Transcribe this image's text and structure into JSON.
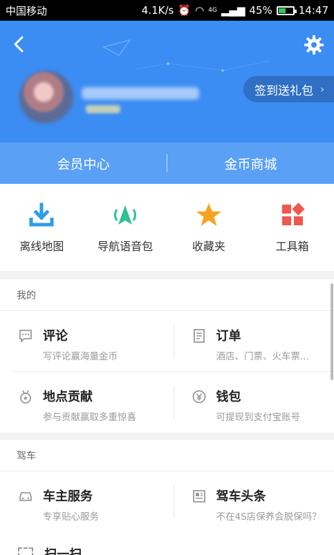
{
  "status_bar": {
    "carrier": "中国移动",
    "network_speed": "4.1K/s",
    "signal_label": "4G",
    "battery_percent_text": "45%",
    "battery_level": 0.45,
    "time": "14:47"
  },
  "header": {
    "signin_label": "签到送礼包",
    "background_color": "#3b8cf3"
  },
  "member_bar": {
    "member_center": "会员中心",
    "coin_mall": "金币商城"
  },
  "tools": [
    {
      "label": "离线地图",
      "icon": "download-icon",
      "color": "#2b9ee8"
    },
    {
      "label": "导航语音包",
      "icon": "voice-navigation-icon",
      "color": "#2ec28f"
    },
    {
      "label": "收藏夹",
      "icon": "star-icon",
      "color": "#f7a321"
    },
    {
      "label": "工具箱",
      "icon": "toolbox-icon",
      "color": "#f0584e"
    }
  ],
  "mine": {
    "title": "我的",
    "items": [
      {
        "title": "评论",
        "desc": "写评论赢海量金币",
        "icon": "comment-icon"
      },
      {
        "title": "订单",
        "desc": "酒店、门票、火车票...",
        "icon": "order-icon"
      },
      {
        "title": "地点贡献",
        "desc": "参与贡献赢取多重惊喜",
        "icon": "medal-icon"
      },
      {
        "title": "钱包",
        "desc": "可提现到支付宝账号",
        "icon": "wallet-icon"
      }
    ]
  },
  "drive": {
    "title": "驾车",
    "items": [
      {
        "title": "车主服务",
        "desc": "专享贴心服务",
        "icon": "car-icon"
      },
      {
        "title": "驾车头条",
        "desc": "不在4S店保养会脱保吗？",
        "icon": "news-icon"
      }
    ],
    "peek_label": "扫一扫"
  }
}
